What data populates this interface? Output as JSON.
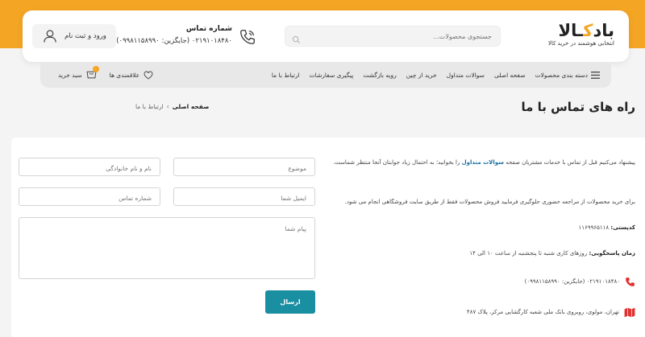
{
  "header": {
    "logo": {
      "text_before": "باد",
      "text_o": "ک",
      "text_after": "ـالا",
      "tagline": "انتخابی هوشمند در خرید کالا"
    },
    "search": {
      "placeholder": "جستجوی محصولات..."
    },
    "phone": {
      "title": "شماره تماس",
      "number": "۰۲۱۹۱۰۱۸۴۸۰ (جایگزین: ۰۹۹۸۱۱۵۸۹۹۰)"
    },
    "login_label": "ورود و ثبت نام"
  },
  "nav": {
    "items": [
      "دسته بندی محصولات",
      "صفحه اصلی",
      "سوالات متداول",
      "خرید از چین",
      "رویه بازگشت",
      "پیگیری سفارشات",
      "ارتباط با ما"
    ],
    "wishlist_label": "علاقمندی ها",
    "cart_label": "سبد خرید",
    "cart_count": "۰"
  },
  "page": {
    "title": "راه های تماس با ما",
    "breadcrumb": {
      "home": "صفحه اصلی",
      "separator": "›",
      "current": "ارتباط با ما"
    }
  },
  "form": {
    "name_placeholder": "نام و نام خانوادگی",
    "subject_placeholder": "موضوع",
    "phone_placeholder": "شماره تماس",
    "email_placeholder": "ایمیل شما",
    "message_placeholder": "پیام شما",
    "submit_label": "ارسال"
  },
  "info": {
    "p1_before": "پیشنهاد می‌کنیم قبل از تماس با خدمات مشتریان صفحه ",
    "p1_link": "سوالات متداول",
    "p1_after": " را بخوانید؛ به احتمال زیاد جوابتان آنجا منتظر شماست.",
    "p2": "برای خرید محصولات از مراجعه حضوری جلوگیری فرمایید فروش محصولات فقط از طریق سایت فروشگاهی انجام می شود.",
    "postal_label": "کدپستی:",
    "postal_value": "۱۱۶۹۹۶۵۱۱۸",
    "hours_label": "زمان پاسخگویی:",
    "hours_value": "روزهای کاری شنبه تا پنجشنبه از ساعت ۱۰ الی ۱۴",
    "phone_value": "۰۲۱۹۱۰۱۸۴۸۰ (جایگزین: ۰۹۹۸۱۱۵۸۹۹۰)",
    "address_value": "تهران، مولوی، روبروی بانک ملی شعبه کارگشایی مرکز، پلاک ۴۸۷"
  },
  "colors": {
    "accent": "#f5a524",
    "button": "#1b8fa2",
    "icon_red": "#e0322f"
  }
}
